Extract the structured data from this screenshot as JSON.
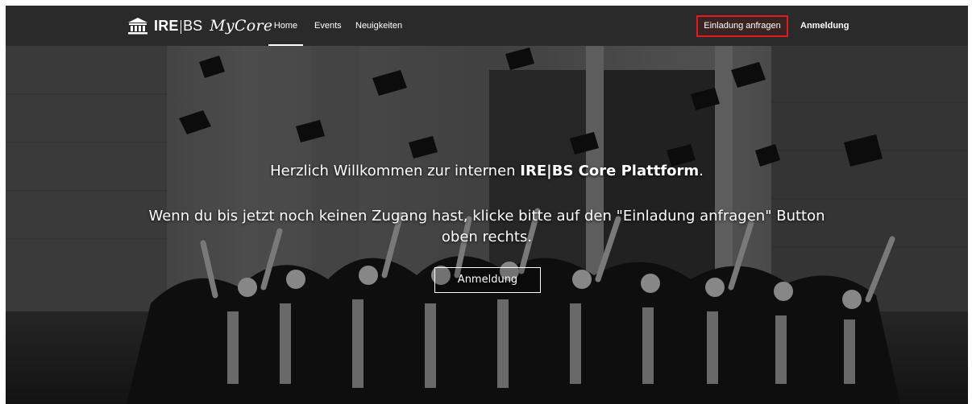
{
  "header": {
    "brand": {
      "strong": "IRE",
      "light": "BS",
      "script": "MyCore"
    },
    "nav": [
      {
        "label": "Home",
        "active": true
      },
      {
        "label": "Events",
        "active": false
      },
      {
        "label": "Neuigkeiten",
        "active": false
      }
    ],
    "invite_button": "Einladung anfragen",
    "login_link": "Anmeldung"
  },
  "hero": {
    "welcome_prefix": "Herzlich Willkommen zur internen ",
    "welcome_strong": "IRE|BS Core Plattform",
    "welcome_suffix": ".",
    "info": "Wenn du bis jetzt noch keinen Zugang hast, klicke bitte auf den \"Einladung anfragen\" Button oben rechts.",
    "login_button": "Anmeldung"
  },
  "colors": {
    "navbar": "#2a2a2a",
    "invite_border": "#e11b22"
  }
}
